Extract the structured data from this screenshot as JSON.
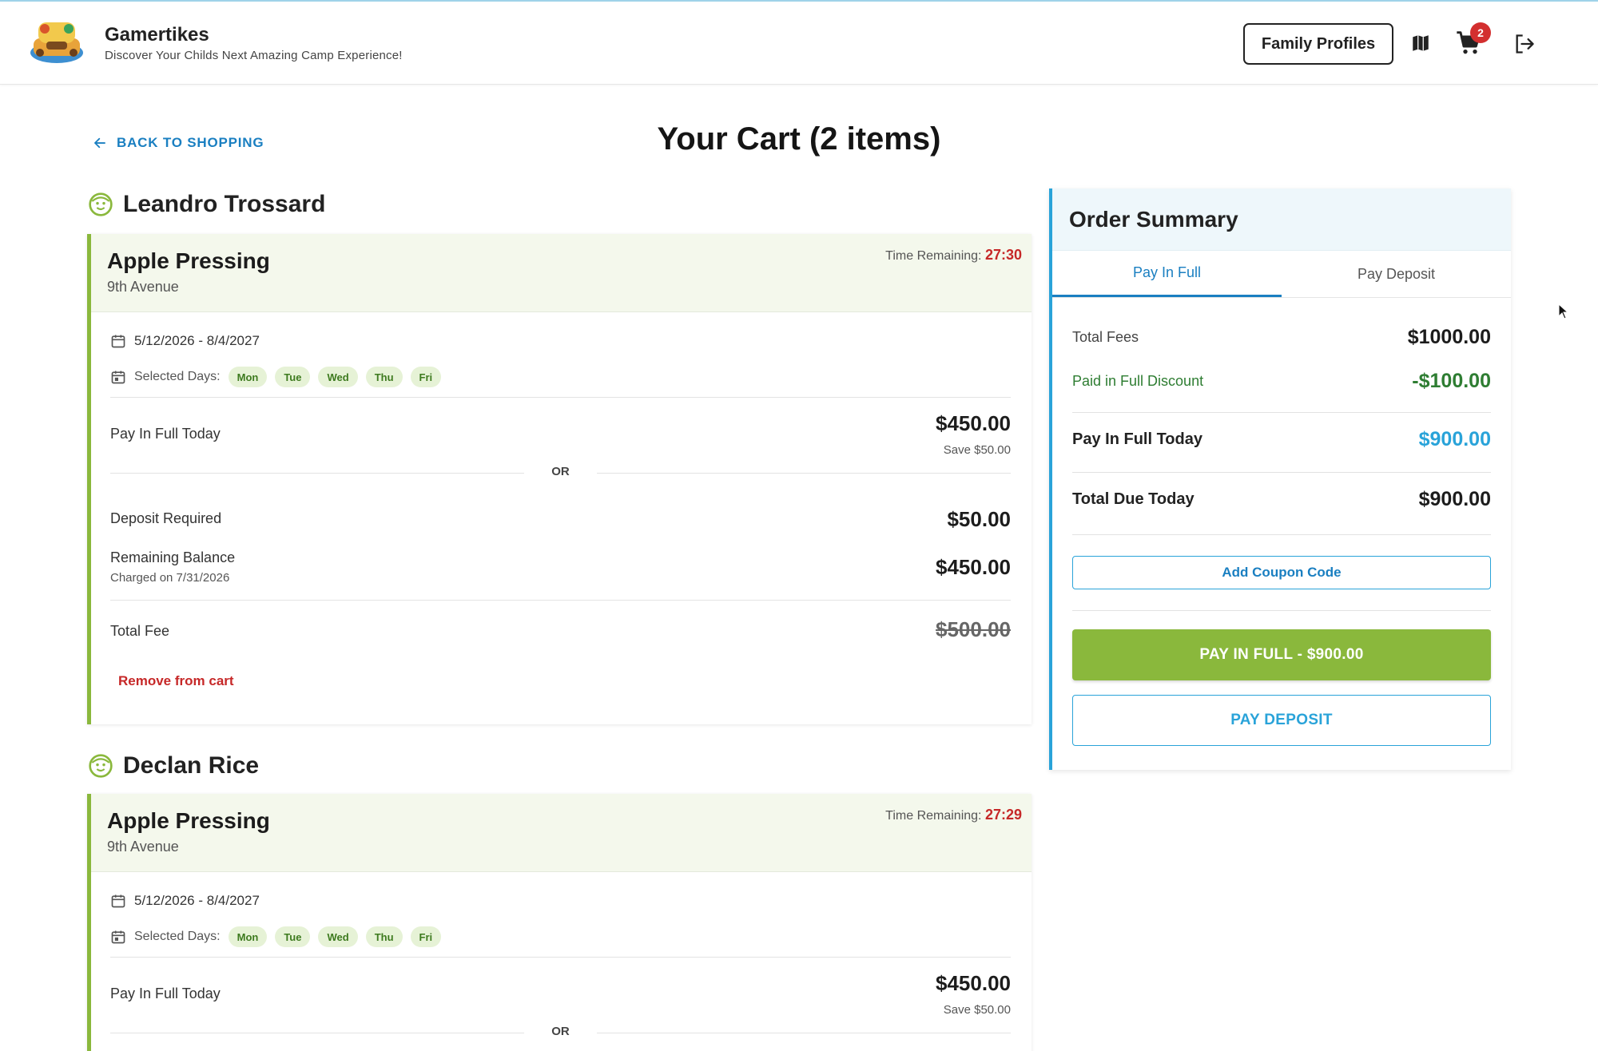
{
  "header": {
    "brand_title": "Gamertikes",
    "brand_subtitle": "Discover Your Childs Next Amazing Camp Experience!",
    "logo_icon": "camp-logo",
    "family_profiles_label": "Family Profiles",
    "map_icon": "map-icon",
    "cart_icon": "cart-icon",
    "cart_count": "2",
    "logout_icon": "logout-icon"
  },
  "page": {
    "back_label": "BACK TO SHOPPING",
    "title": "Your Cart (2 items)"
  },
  "children": [
    {
      "name": "Leandro Trossard",
      "camp": {
        "name": "Apple Pressing",
        "location": "9th Avenue",
        "time_label": "Time Remaining:",
        "time_value": "27:30",
        "dates": "5/12/2026 - 8/4/2027",
        "days_label": "Selected Days:",
        "days": [
          "Mon",
          "Tue",
          "Wed",
          "Thu",
          "Fri"
        ],
        "pay_full_label": "Pay In Full Today",
        "pay_full_amount": "$450.00",
        "pay_full_save": "Save $50.00",
        "or_label": "OR",
        "deposit_label": "Deposit Required",
        "deposit_amount": "$50.00",
        "remaining_label": "Remaining Balance",
        "remaining_note": "Charged on 7/31/2026",
        "remaining_amount": "$450.00",
        "total_label": "Total Fee",
        "total_amount": "$500.00",
        "remove_label": "Remove from cart"
      }
    },
    {
      "name": "Declan Rice",
      "camp": {
        "name": "Apple Pressing",
        "location": "9th Avenue",
        "time_label": "Time Remaining:",
        "time_value": "27:29",
        "dates": "5/12/2026 - 8/4/2027",
        "days_label": "Selected Days:",
        "days": [
          "Mon",
          "Tue",
          "Wed",
          "Thu",
          "Fri"
        ],
        "pay_full_label": "Pay In Full Today",
        "pay_full_amount": "$450.00",
        "pay_full_save": "Save $50.00",
        "or_label": "OR"
      }
    }
  ],
  "summary": {
    "title": "Order Summary",
    "tabs": [
      "Pay In Full",
      "Pay Deposit"
    ],
    "active_tab": "Pay In Full",
    "total_fees_label": "Total Fees",
    "total_fees_value": "$1000.00",
    "discount_label": "Paid in Full Discount",
    "discount_value": "-$100.00",
    "pay_today_label": "Pay In Full Today",
    "pay_today_value": "$900.00",
    "due_label": "Total Due Today",
    "due_value": "$900.00",
    "coupon_label": "Add Coupon Code",
    "pay_full_button": "PAY IN FULL - $900.00",
    "pay_deposit_button": "PAY DEPOSIT"
  },
  "colors": {
    "accent_green": "#8ab83c",
    "accent_blue": "#29a3d9",
    "link_blue": "#1a7fc1",
    "timer_red": "#c62828"
  }
}
